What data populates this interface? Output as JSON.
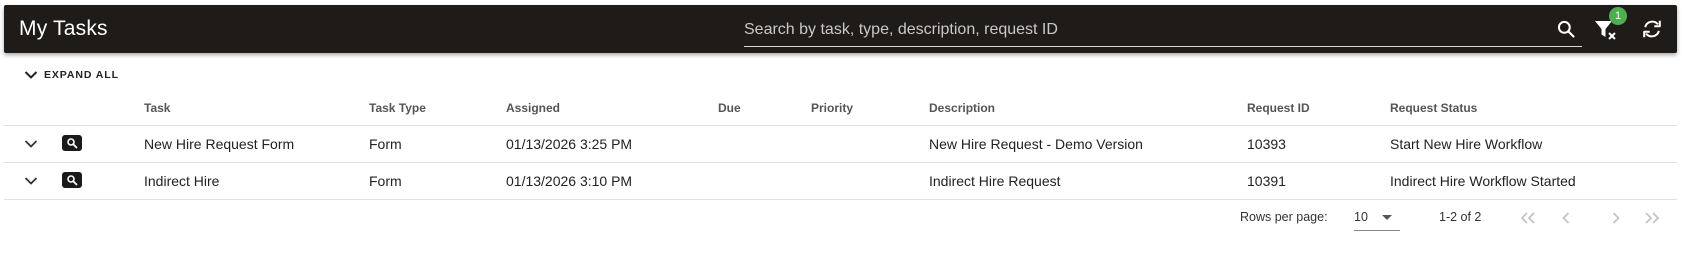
{
  "header": {
    "title": "My Tasks",
    "search_placeholder": "Search by task, type, description, request ID",
    "filter_badge_count": "1"
  },
  "toolbar_icons": [
    "search-icon",
    "filter-clear-icon",
    "refresh-icon"
  ],
  "expand_all_label": "EXPAND ALL",
  "table": {
    "columns": [
      "Task",
      "Task Type",
      "Assigned",
      "Due",
      "Priority",
      "Description",
      "Request ID",
      "Request Status"
    ],
    "rows": [
      {
        "task": "New Hire Request Form",
        "task_type": "Form",
        "assigned": "01/13/2026 3:25 PM",
        "due": "",
        "priority": "",
        "description": "New Hire Request - Demo Version",
        "request_id": "10393",
        "request_status": "Start New Hire Workflow"
      },
      {
        "task": "Indirect Hire",
        "task_type": "Form",
        "assigned": "01/13/2026 3:10 PM",
        "due": "",
        "priority": "",
        "description": "Indirect Hire Request",
        "request_id": "10391",
        "request_status": "Indirect Hire Workflow Started"
      }
    ]
  },
  "pagination": {
    "rows_per_page_label": "Rows per page:",
    "rows_per_page_value": "10",
    "range_text": "1-2 of 2"
  },
  "colors": {
    "toolbar_bg": "#1e1b19",
    "badge": "#4caf50",
    "disabled_nav": "#c4c4c4"
  }
}
